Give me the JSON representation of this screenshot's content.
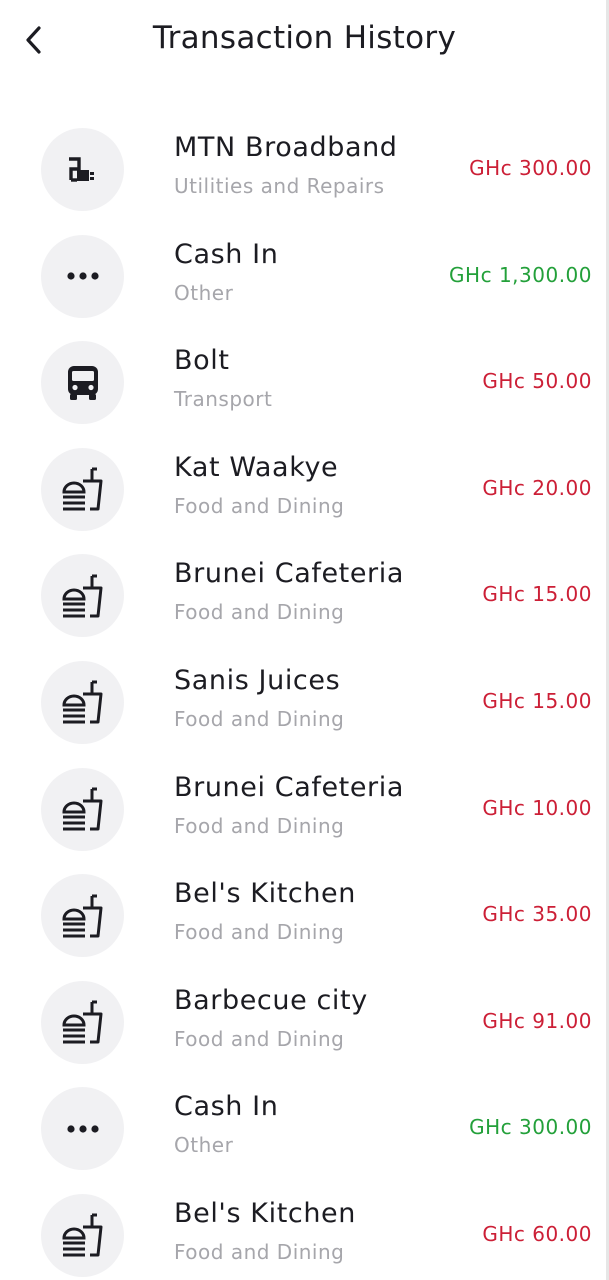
{
  "header": {
    "title": "Transaction History",
    "back_icon": "chevron-left-icon"
  },
  "colors": {
    "debit": "#cc1f36",
    "credit": "#23a03a",
    "avatar_bg": "#f1f1f3"
  },
  "transactions": [
    {
      "name": "MTN Broadband",
      "category": "Utilities and Repairs",
      "amount": "GHc 300.00",
      "type": "debit",
      "icon": "utilities-icon"
    },
    {
      "name": "Cash In",
      "category": "Other",
      "amount": "GHc 1,300.00",
      "type": "credit",
      "icon": "more-dots-icon"
    },
    {
      "name": "Bolt",
      "category": "Transport",
      "amount": "GHc 50.00",
      "type": "debit",
      "icon": "bus-icon"
    },
    {
      "name": "Kat Waakye",
      "category": "Food and Dining",
      "amount": "GHc 20.00",
      "type": "debit",
      "icon": "fastfood-icon"
    },
    {
      "name": "Brunei Cafeteria",
      "category": "Food and Dining",
      "amount": "GHc 15.00",
      "type": "debit",
      "icon": "fastfood-icon"
    },
    {
      "name": "Sanis Juices",
      "category": "Food and Dining",
      "amount": "GHc 15.00",
      "type": "debit",
      "icon": "fastfood-icon"
    },
    {
      "name": "Brunei Cafeteria",
      "category": "Food and Dining",
      "amount": "GHc 10.00",
      "type": "debit",
      "icon": "fastfood-icon"
    },
    {
      "name": "Bel's Kitchen",
      "category": "Food and Dining",
      "amount": "GHc 35.00",
      "type": "debit",
      "icon": "fastfood-icon"
    },
    {
      "name": "Barbecue city",
      "category": "Food and Dining",
      "amount": "GHc 91.00",
      "type": "debit",
      "icon": "fastfood-icon"
    },
    {
      "name": "Cash In",
      "category": "Other",
      "amount": "GHc 300.00",
      "type": "credit",
      "icon": "more-dots-icon"
    },
    {
      "name": "Bel's Kitchen",
      "category": "Food and Dining",
      "amount": "GHc 60.00",
      "type": "debit",
      "icon": "fastfood-icon"
    }
  ]
}
